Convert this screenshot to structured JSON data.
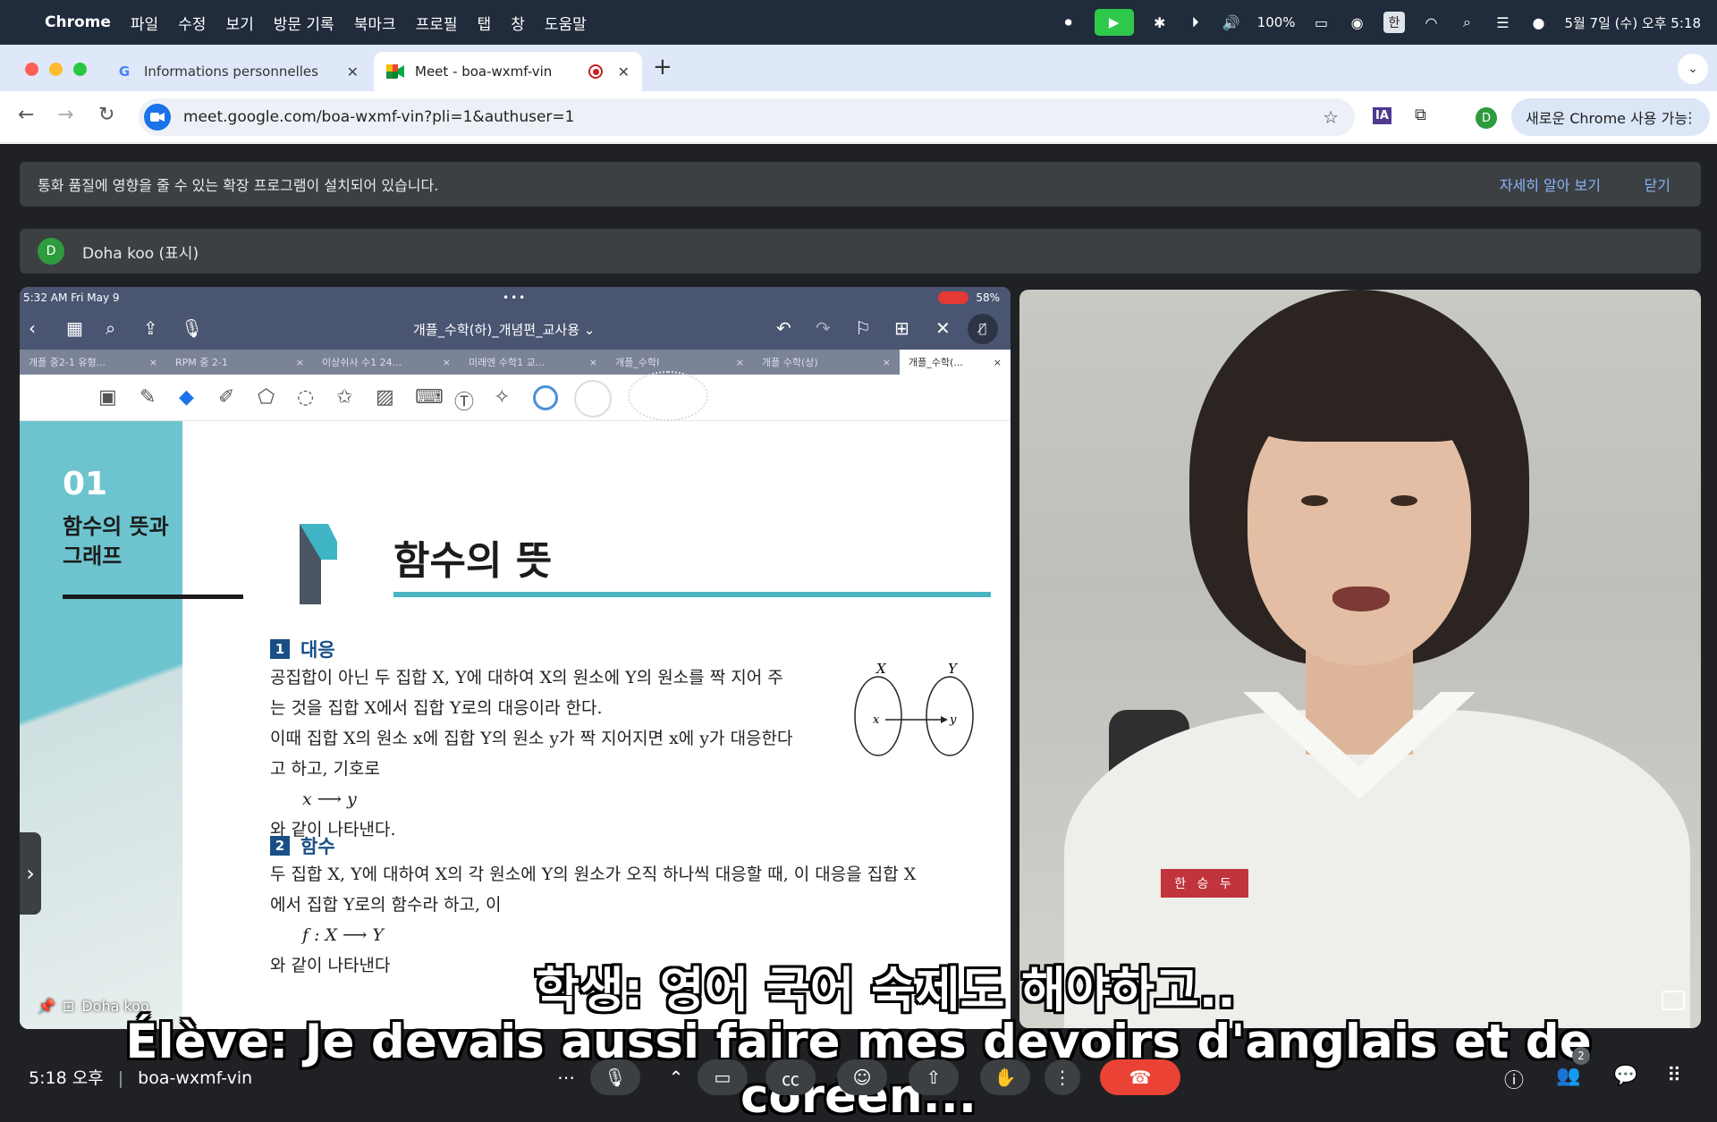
{
  "menubar": {
    "app": "Chrome",
    "items": [
      "파일",
      "수정",
      "보기",
      "방문 기록",
      "북마크",
      "프로필",
      "탭",
      "창",
      "도움말"
    ],
    "battery": "100%",
    "input_lang": "한",
    "datetime": "5월 7일 (수) 오후 5:18"
  },
  "tabs": [
    {
      "title": "Informations personnelles",
      "favicon": "google-g-icon"
    },
    {
      "title": "Meet - boa-wxmf-vin",
      "favicon": "meet-icon",
      "recording": true
    }
  ],
  "toolbar": {
    "url": "meet.google.com/boa-wxmf-vin?pli=1&authuser=1",
    "profile_initial": "D",
    "extension_label": "IA",
    "new_chrome": "새로운 Chrome 사용 가능"
  },
  "banner": {
    "message": "통화 품질에 영향을 줄 수 있는 확장 프로그램이 설치되어 있습니다.",
    "learn_more": "자세히 알아 보기",
    "close": "닫기"
  },
  "presenter": {
    "initial": "D",
    "label": "Doha koo (표시)"
  },
  "ipad": {
    "time": "5:32 AM  Fri May 9",
    "battery": "58%",
    "doc_title": "개플_수학(하)_개념편_교사용 ⌄",
    "doc_tabs": [
      "개플 중2-1 유형...",
      "RPM 중 2-1",
      "이상쉬사 수1 24...",
      "미래엔 수학1 교...",
      "개플_수학I",
      "개플 수학(상)",
      "개플_수학(..."
    ],
    "chapter_num": "01",
    "chapter_name": "함수의 뜻과 그래프",
    "title": "함수의 뜻",
    "sec1_num": "1",
    "sec1_title": "대응",
    "sec1_lines": [
      "공집합이 아닌 두 집합 X, Y에 대하여 X의 원소에 Y의 원소를 짝 지어 주",
      "는 것을 집합 X에서 집합 Y로의 대응이라 한다.",
      "이때 집합 X의 원소 x에 집합 Y의 원소 y가 짝 지어지면 x에 y가 대응한다",
      "고 하고, 기호로",
      "x ⟶ y",
      "와 같이 나타낸다."
    ],
    "diagram": {
      "set_x": "X",
      "set_y": "Y",
      "elem_x": "x",
      "elem_y": "y"
    },
    "sec2_num": "2",
    "sec2_title": "함수",
    "sec2_lines": [
      "두 집합 X, Y에 대하여 X의 각 원소에 Y의 원소가 오직 하나씩 대응할 때, 이 대응을 집합 X",
      "에서 집합 Y로의 함수라 하고, 이",
      "f : X ⟶ Y",
      "와 같이 나타낸다"
    ],
    "share_label": "Doha koo"
  },
  "video": {
    "nametag": "한 승 두"
  },
  "subtitles": {
    "ko": "학생: 영어 국어 숙제도 해야하고..",
    "fr": "Élève: Je devais aussi faire mes devoirs d'anglais et de coréen..."
  },
  "bottombar": {
    "time": "5:18 오후",
    "separator": "|",
    "meeting_code": "boa-wxmf-vin",
    "participants_count": "2"
  }
}
